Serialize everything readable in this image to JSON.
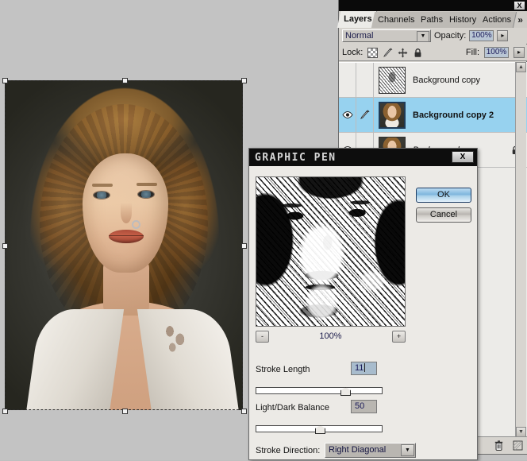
{
  "app": {
    "workspace_bg": "#c3c3c3"
  },
  "document": {
    "name": "portrait-canvas",
    "selection": {
      "handles": 8,
      "dashed_border": true
    }
  },
  "layers_panel": {
    "close_label": "X",
    "tabs": [
      {
        "label": "Layers",
        "active": true
      },
      {
        "label": "Channels",
        "active": false
      },
      {
        "label": "Paths",
        "active": false
      },
      {
        "label": "History",
        "active": false
      },
      {
        "label": "Actions",
        "active": false
      }
    ],
    "overflow_label": "»",
    "blend_mode": "Normal",
    "opacity_label": "Opacity:",
    "opacity_value": "100%",
    "fill_label": "Fill:",
    "fill_value": "100%",
    "lock_label": "Lock:",
    "lock_icons": [
      "transparency-checker",
      "paintbrush",
      "move-arrows",
      "padlock"
    ],
    "spinner_glyph": "▸",
    "layers": [
      {
        "name": "Background copy",
        "visible": false,
        "linked": false,
        "selected": false,
        "locked": false,
        "style": "normal",
        "thumb": "sketch"
      },
      {
        "name": "Background copy 2",
        "visible": true,
        "linked": true,
        "selected": true,
        "locked": false,
        "style": "bold",
        "thumb": "portrait"
      },
      {
        "name": "Background",
        "visible": true,
        "linked": false,
        "selected": false,
        "locked": true,
        "style": "italic",
        "thumb": "portrait"
      }
    ],
    "scroll_up": "▲",
    "scroll_down": "▼",
    "footer_icons": [
      "trash-icon",
      "new-layer-icon"
    ]
  },
  "graphic_pen_dialog": {
    "title": "GRAPHIC PEN",
    "close_label": "X",
    "ok_label": "OK",
    "cancel_label": "Cancel",
    "zoom_out_label": "-",
    "zoom_in_label": "+",
    "zoom_value": "100%",
    "stroke_length": {
      "label": "Stroke Length",
      "value": "11",
      "min": 1,
      "max": 15,
      "percent": 70
    },
    "light_dark_balance": {
      "label": "Light/Dark Balance",
      "value": "50",
      "min": 0,
      "max": 100,
      "percent": 50
    },
    "stroke_direction": {
      "label": "Stroke Direction:",
      "value": "Right Diagonal"
    }
  },
  "colors": {
    "panel_bg": "#d6d3ce",
    "list_bg": "#ecebe8",
    "selected_layer": "#97d2ef",
    "dialog_bg": "#eceae6",
    "titlebar": "#0d0d0d",
    "ok_accent": "#7fb6dd",
    "workspace": "#c3c3c3"
  }
}
